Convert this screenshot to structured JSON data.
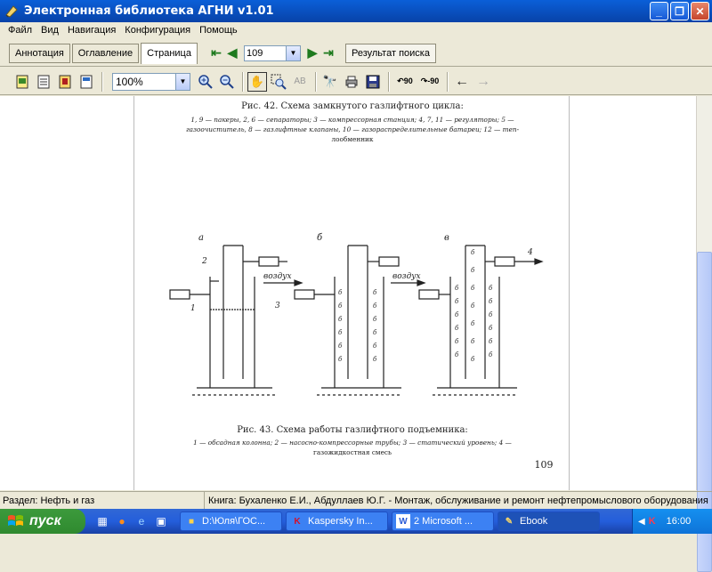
{
  "window": {
    "title": "Электронная библиотека АГНИ v1.01"
  },
  "menu": [
    "Файл",
    "Вид",
    "Навигация",
    "Конфигурация",
    "Помощь"
  ],
  "tabs": [
    {
      "label": "Аннотация"
    },
    {
      "label": "Оглавление"
    },
    {
      "label": "Страница"
    }
  ],
  "nav": {
    "page_value": "109",
    "search_result_label": "Результат поиска"
  },
  "toolbar": {
    "zoom_value": "100%"
  },
  "document": {
    "fig42_title": "Рис. 42. Схема замкнутого газлифтного цикла:",
    "fig42_caption_line1": "1, 9 — пакеры, 2, 6 — сепараторы; 3 — компрессорная станция; 4, 7, 11 — регуляторы; 5 —",
    "fig42_caption_line2": "газоочиститель, 8 — газлифтные клапаны, 10 — газораспределительные батареи; 12 — теп-",
    "fig42_caption_line3": "лообменник",
    "fig43_label_a": "а",
    "fig43_label_b": "б",
    "fig43_label_v": "в",
    "fig43_air1": "воздух",
    "fig43_air2": "воздух",
    "fig43_num1": "1",
    "fig43_num2": "2",
    "fig43_num3": "3",
    "fig43_num4": "4",
    "fig43_title": "Рис. 43. Схема работы газлифтного подъемника:",
    "fig43_caption_line1": "1 — обсадная колонна; 2 — насосно-компрессорные трубы; 3 — статический уровень; 4 —",
    "fig43_caption_line2": "газожидкостная смесь",
    "page_number": "109"
  },
  "status": {
    "section": "Раздел: Нефть и газ",
    "book": "Книга: Бухаленко Е.И., Абдуллаев Ю.Г. - Монтаж, обслуживание и ремонт нефтепромыслового оборудования"
  },
  "taskbar": {
    "start_label": "пуск",
    "tasks": [
      {
        "label": "D:\\Юля\\ГОС..."
      },
      {
        "label": "Kaspersky In..."
      },
      {
        "label": "2 Microsoft ..."
      },
      {
        "label": "Ebook"
      }
    ],
    "clock": "16:00"
  },
  "colors": {
    "titlebar": "#0842a8",
    "taskbar": "#245edb",
    "start": "#2f8a2f"
  }
}
